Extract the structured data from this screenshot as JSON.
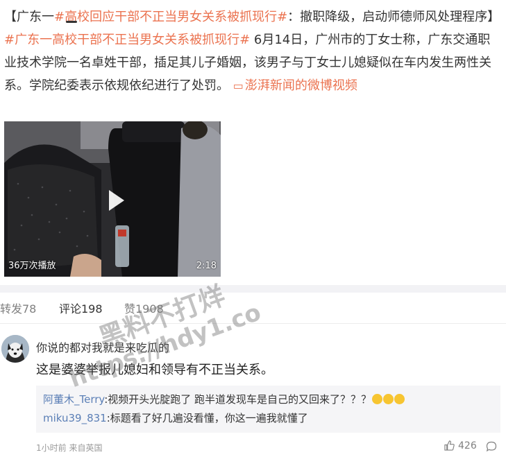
{
  "post": {
    "prefix": "【广东一",
    "tag_title": "#高校回应干部不正当男女关系被抓现行#",
    "summary": "：撤职降级，启动师德师风处理程序】",
    "tag_body": "#广东一高校干部不正当男女关系被抓现行#",
    "body": " 6月14日，广州市的丁女士称，广东交通职业技术学院一名卓姓干部，插足其儿子婚姻，该男子与丁女士儿媳疑似在车内发生两性关系。学院纪委表示依规依纪进行了处罚。",
    "video_link_text": "澎湃新闻的微博视频"
  },
  "video": {
    "views": "36万次播放",
    "duration": "2:18",
    "play_icon": "play-icon"
  },
  "tabs": {
    "repost": "转发78",
    "comment": "评论198",
    "like": "赞1908"
  },
  "comment": {
    "username": "你说的都对我就是来吃瓜的",
    "text": "这是婆婆举报儿媳妇和领导有不正当关系。",
    "replies": [
      {
        "user": "阿董木_Terry",
        "text": ":视频开头光腚跑了 跑半道发现车是自己的又回来了？？？"
      },
      {
        "user": "miku39_831",
        "text": ":标题看了好几遍没看懂，你这一遍我就懂了"
      }
    ],
    "meta": "1小时前 来自英国",
    "like_count": "426"
  },
  "watermark": {
    "line1": "黑料不打烊",
    "line2": "https://hdy1.co"
  },
  "colors": {
    "tag": "#eb7350",
    "reply_user": "#5b7fb6",
    "reply_bg": "#f5f5f7"
  }
}
